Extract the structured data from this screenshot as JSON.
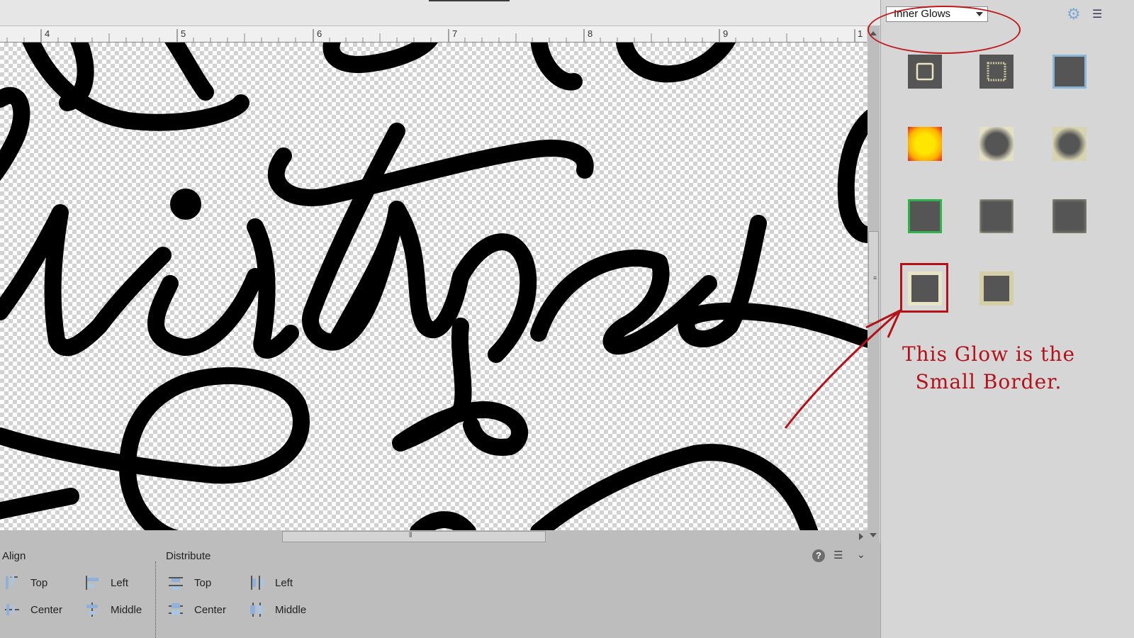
{
  "ruler": {
    "ticks": [
      "4",
      "5",
      "6",
      "7",
      "8",
      "9",
      "1"
    ]
  },
  "right_panel": {
    "dropdown_value": "Inner Glows",
    "annotation_line1": "This Glow is the",
    "annotation_line2": "Small Border."
  },
  "align": {
    "title": "Align",
    "top": "Top",
    "center": "Center",
    "left": "Left",
    "middle": "Middle"
  },
  "distribute": {
    "title": "Distribute",
    "top": "Top",
    "center": "Center",
    "left": "Left",
    "middle": "Middle"
  },
  "help_label": "?",
  "colors": {
    "annotation_red": "#b3121a",
    "swatch_gray": "#555555",
    "accent_blue": "#7fa9d4"
  }
}
